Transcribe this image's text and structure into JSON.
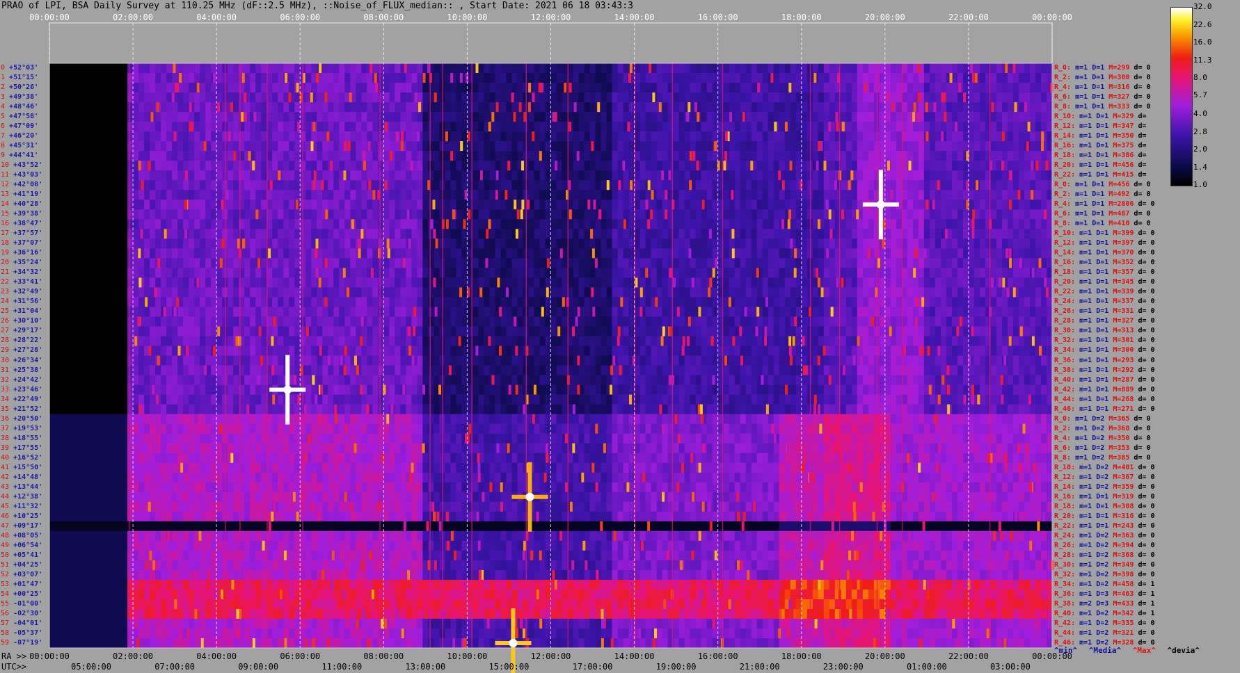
{
  "header": {
    "title": "PRAO of LPI, BSA Daily Survey at 110.25 MHz (dF::2.5 MHz), ::Noise_of_FLUX_median:: , Start Date: 2021 06 18 03:43:3"
  },
  "time_axis": {
    "top_ticks": [
      "00:00:00",
      "02:00:00",
      "04:00:00",
      "06:00:00",
      "08:00:00",
      "10:00:00",
      "12:00:00",
      "14:00:00",
      "16:00:00",
      "18:00:00",
      "20:00:00",
      "22:00:00",
      "00:00:00"
    ],
    "ra_label": "RA >>",
    "ra_ticks": [
      "00:00:00",
      "02:00:00",
      "04:00:00",
      "06:00:00",
      "08:00:00",
      "10:00:00",
      "12:00:00",
      "14:00:00",
      "16:00:00",
      "18:00:00",
      "20:00:00",
      "22:00:00",
      "00:00:00"
    ],
    "utc_label": "UTC>>",
    "utc_ticks": [
      "05:00:00",
      "07:00:00",
      "09:00:00",
      "11:00:00",
      "13:00:00",
      "15:00:00",
      "17:00:00",
      "19:00:00",
      "21:00:00",
      "23:00:00",
      "01:00:00",
      "03:00:00"
    ]
  },
  "declinations": [
    "+52°03'",
    "+51°15'",
    "+50°26'",
    "+49°38'",
    "+48°46'",
    "+47°58'",
    "+47°09'",
    "+46°20'",
    "+45°31'",
    "+44°41'",
    "+43°52'",
    "+43°03'",
    "+42°08'",
    "+41°19'",
    "+40°28'",
    "+39°38'",
    "+38°47'",
    "+37°57'",
    "+37°07'",
    "+36°16'",
    "+35°24'",
    "+34°32'",
    "+33°41'",
    "+32°49'",
    "+31°56'",
    "+31°04'",
    "+30°10'",
    "+29°17'",
    "+28°22'",
    "+27°28'",
    "+26°34'",
    "+25°38'",
    "+24°42'",
    "+23°46'",
    "+22°49'",
    "+21°52'",
    "+20°50'",
    "+19°53'",
    "+18°55'",
    "+17°55'",
    "+16°52'",
    "+15°50'",
    "+14°48'",
    "+13°44'",
    "+12°38'",
    "+11°32'",
    "+10°25'",
    "+09°17'",
    "+08°05'",
    "+06°54'",
    "+05°41'",
    "+04°25'",
    "+03°07'",
    "+01°47'",
    "+00°25'",
    "-01°00'",
    "-02°30'",
    "-04°01'",
    "-05°37'",
    "-07°19'"
  ],
  "row_indices": [
    "0",
    "1",
    "2",
    "3",
    "4",
    "5",
    "6",
    "7",
    "8",
    "9",
    "10",
    "11",
    "12",
    "13",
    "14",
    "15",
    "16",
    "17",
    "18",
    "19",
    "20",
    "21",
    "22",
    "23",
    "24",
    "25",
    "26",
    "27",
    "28",
    "29",
    "30",
    "31",
    "32",
    "33",
    "34",
    "35",
    "36",
    "37",
    "38",
    "39",
    "40",
    "41",
    "42",
    "43",
    "44",
    "45",
    "46",
    "47",
    "48",
    "49",
    "50",
    "51",
    "52",
    "53",
    "54",
    "55",
    "56",
    "57",
    "58",
    "59"
  ],
  "beams": [
    {
      "r": "R_0:",
      "m": "m=1",
      "D": "D=1",
      "M": "M=299",
      "d": "d= 0"
    },
    {
      "r": "R_2:",
      "m": "m=1",
      "D": "D=1",
      "M": "M=300",
      "d": "d= 0"
    },
    {
      "r": "R_4:",
      "m": "m=1",
      "D": "D=1",
      "M": "M=316",
      "d": "d= 0"
    },
    {
      "r": "R_6:",
      "m": "m=1",
      "D": "D=1",
      "M": "M=327",
      "d": "d= 0"
    },
    {
      "r": "R_8:",
      "m": "m=1",
      "D": "D=1",
      "M": "M=333",
      "d": "d= 0"
    },
    {
      "r": "R_10:",
      "m": "m=1",
      "D": "D=1",
      "M": "M=329",
      "d": "d="
    },
    {
      "r": "R_12:",
      "m": "m=1",
      "D": "D=1",
      "M": "M=347",
      "d": "d="
    },
    {
      "r": "R_14:",
      "m": "m=1",
      "D": "D=1",
      "M": "M=350",
      "d": "d="
    },
    {
      "r": "R_16:",
      "m": "m=1",
      "D": "D=1",
      "M": "M=375",
      "d": "d="
    },
    {
      "r": "R_18:",
      "m": "m=1",
      "D": "D=1",
      "M": "M=386",
      "d": "d="
    },
    {
      "r": "R_20:",
      "m": "m=1",
      "D": "D=1",
      "M": "M=456",
      "d": "d="
    },
    {
      "r": "R_22:",
      "m": "m=1",
      "D": "D=1",
      "M": "M=415",
      "d": "d="
    },
    {
      "r": "R_0:",
      "m": "m=1",
      "D": "D=1",
      "M": "M=456",
      "d": "d= 0"
    },
    {
      "r": "R_2:",
      "m": "m=1",
      "D": "D=1",
      "M": "M=492",
      "d": "d= 0"
    },
    {
      "r": "R_4:",
      "m": "m=1",
      "D": "D=1",
      "M": "M=2806",
      "d": "d= 0"
    },
    {
      "r": "R_6:",
      "m": "m=1",
      "D": "D=1",
      "M": "M=487",
      "d": "d= 0"
    },
    {
      "r": "R_8:",
      "m": "m=1",
      "D": "D=1",
      "M": "M=410",
      "d": "d= 0"
    },
    {
      "r": "R_10:",
      "m": "m=1",
      "D": "D=1",
      "M": "M=399",
      "d": "d= 0"
    },
    {
      "r": "R_12:",
      "m": "m=1",
      "D": "D=1",
      "M": "M=397",
      "d": "d= 0"
    },
    {
      "r": "R_14:",
      "m": "m=1",
      "D": "D=1",
      "M": "M=370",
      "d": "d= 0"
    },
    {
      "r": "R_16:",
      "m": "m=1",
      "D": "D=1",
      "M": "M=352",
      "d": "d= 0"
    },
    {
      "r": "R_18:",
      "m": "m=1",
      "D": "D=1",
      "M": "M=357",
      "d": "d= 0"
    },
    {
      "r": "R_20:",
      "m": "m=1",
      "D": "D=1",
      "M": "M=345",
      "d": "d= 0"
    },
    {
      "r": "R_22:",
      "m": "m=1",
      "D": "D=1",
      "M": "M=339",
      "d": "d= 0"
    },
    {
      "r": "R_24:",
      "m": "m=1",
      "D": "D=1",
      "M": "M=337",
      "d": "d= 0"
    },
    {
      "r": "R_26:",
      "m": "m=1",
      "D": "D=1",
      "M": "M=331",
      "d": "d= 0"
    },
    {
      "r": "R_28:",
      "m": "m=1",
      "D": "D=1",
      "M": "M=327",
      "d": "d= 0"
    },
    {
      "r": "R_30:",
      "m": "m=1",
      "D": "D=1",
      "M": "M=313",
      "d": "d= 0"
    },
    {
      "r": "R_32:",
      "m": "m=1",
      "D": "D=1",
      "M": "M=301",
      "d": "d= 0"
    },
    {
      "r": "R_34:",
      "m": "m=1",
      "D": "D=1",
      "M": "M=300",
      "d": "d= 0"
    },
    {
      "r": "R_36:",
      "m": "m=1",
      "D": "D=1",
      "M": "M=293",
      "d": "d= 0"
    },
    {
      "r": "R_38:",
      "m": "m=1",
      "D": "D=1",
      "M": "M=292",
      "d": "d= 0"
    },
    {
      "r": "R_40:",
      "m": "m=1",
      "D": "D=1",
      "M": "M=287",
      "d": "d= 0"
    },
    {
      "r": "R_42:",
      "m": "m=1",
      "D": "D=1",
      "M": "M=889",
      "d": "d= 0"
    },
    {
      "r": "R_44:",
      "m": "m=1",
      "D": "D=1",
      "M": "M=268",
      "d": "d= 0"
    },
    {
      "r": "R_46:",
      "m": "m=1",
      "D": "D=1",
      "M": "M=271",
      "d": "d= 0"
    },
    {
      "r": "R_0:",
      "m": "m=1",
      "D": "D=2",
      "M": "M=365",
      "d": "d= 0"
    },
    {
      "r": "R_2:",
      "m": "m=1",
      "D": "D=2",
      "M": "M=368",
      "d": "d= 0"
    },
    {
      "r": "R_4:",
      "m": "m=1",
      "D": "D=2",
      "M": "M=350",
      "d": "d= 0"
    },
    {
      "r": "R_6:",
      "m": "m=1",
      "D": "D=2",
      "M": "M=353",
      "d": "d= 0"
    },
    {
      "r": "R_8:",
      "m": "m=1",
      "D": "D=2",
      "M": "M=385",
      "d": "d= 0"
    },
    {
      "r": "R_10:",
      "m": "m=1",
      "D": "D=2",
      "M": "M=401",
      "d": "d= 0"
    },
    {
      "r": "R_12:",
      "m": "m=1",
      "D": "D=2",
      "M": "M=367",
      "d": "d= 0"
    },
    {
      "r": "R_14:",
      "m": "m=1",
      "D": "D=2",
      "M": "M=359",
      "d": "d= 0"
    },
    {
      "r": "R_16:",
      "m": "m=1",
      "D": "D=1",
      "M": "M=319",
      "d": "d= 0"
    },
    {
      "r": "R_18:",
      "m": "m=1",
      "D": "D=1",
      "M": "M=308",
      "d": "d= 0"
    },
    {
      "r": "R_20:",
      "m": "m=1",
      "D": "D=1",
      "M": "M=316",
      "d": "d= 0"
    },
    {
      "r": "R_22:",
      "m": "m=1",
      "D": "D=1",
      "M": "M=243",
      "d": "d= 0"
    },
    {
      "r": "R_24:",
      "m": "m=1",
      "D": "D=2",
      "M": "M=363",
      "d": "d= 0"
    },
    {
      "r": "R_26:",
      "m": "m=1",
      "D": "D=2",
      "M": "M=394",
      "d": "d= 0"
    },
    {
      "r": "R_28:",
      "m": "m=1",
      "D": "D=2",
      "M": "M=368",
      "d": "d= 0"
    },
    {
      "r": "R_30:",
      "m": "m=1",
      "D": "D=2",
      "M": "M=349",
      "d": "d= 0"
    },
    {
      "r": "R_32:",
      "m": "m=1",
      "D": "D=2",
      "M": "M=398",
      "d": "d= 0"
    },
    {
      "r": "R_34:",
      "m": "m=1",
      "D": "D=2",
      "M": "M=458",
      "d": "d= 1"
    },
    {
      "r": "R_36:",
      "m": "m=1",
      "D": "D=3",
      "M": "M=463",
      "d": "d= 1"
    },
    {
      "r": "R_38:",
      "m": "m=2",
      "D": "D=3",
      "M": "M=433",
      "d": "d= 1"
    },
    {
      "r": "R_40:",
      "m": "m=1",
      "D": "D=2",
      "M": "M=342",
      "d": "d= 1"
    },
    {
      "r": "R_42:",
      "m": "m=1",
      "D": "D=2",
      "M": "M=335",
      "d": "d= 0"
    },
    {
      "r": "R_44:",
      "m": "m=1",
      "D": "D=2",
      "M": "M=321",
      "d": "d= 0"
    },
    {
      "r": "R_46:",
      "m": "m=1",
      "D": "D=2",
      "M": "M=328",
      "d": "d= 0"
    }
  ],
  "legend": {
    "min": "^min^",
    "median": "^Media^",
    "max": "^Max^",
    "dev": "^devia^"
  },
  "colors": {
    "min": "#1010a0",
    "median": "#1010a0",
    "max": "#e01010",
    "dev": "#000000"
  },
  "chart_data": {
    "type": "heatmap",
    "title": "PRAO of LPI, BSA Daily Survey at 110.25 MHz (dF::2.5 MHz), ::Noise_of_FLUX_median:: , Start Date: 2021 06 18 03:43:3",
    "x": "RA (hours)",
    "xlim": [
      0,
      24
    ],
    "rows": 60,
    "colormap": "black-blue-purple-red-yellow-white",
    "colorbar_ticks": [
      "32.0",
      "22.6",
      "16.0",
      "11.3",
      "8.0",
      "5.7",
      "4.0",
      "2.8",
      "2.0",
      "1.4",
      "1.0"
    ],
    "colorbar_range": [
      1.0,
      32.0
    ],
    "colorbar_scale": "log",
    "bright_sources": [
      {
        "ra": 5.7,
        "dec_row": 33,
        "level": 32
      },
      {
        "ra": 19.9,
        "dec_row": 14,
        "level": 32
      },
      {
        "ra": 11.5,
        "dec_row": 44,
        "level": 20
      },
      {
        "ra": 11.1,
        "dec_row": 59,
        "level": 22
      }
    ]
  }
}
